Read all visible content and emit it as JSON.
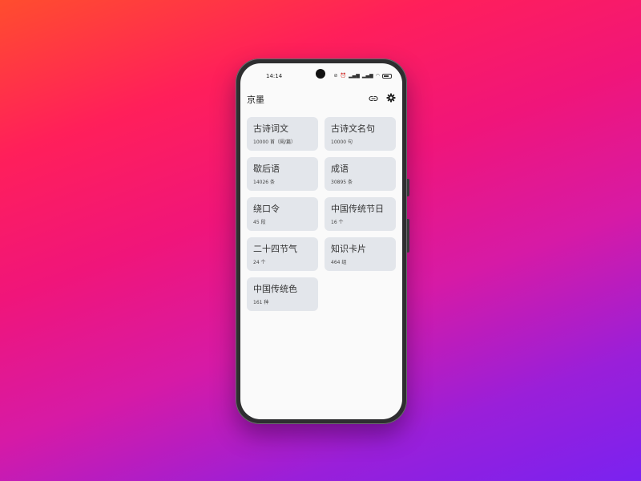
{
  "status_bar": {
    "time": "14:14",
    "icons": [
      "do-not-disturb-icon",
      "alarm-icon",
      "signal-icon-1",
      "signal-icon-2",
      "wifi-icon",
      "battery-icon"
    ]
  },
  "app_bar": {
    "title": "京墨",
    "actions": [
      "link-icon",
      "settings-icon"
    ]
  },
  "cards": [
    {
      "title": "古诗词文",
      "count": "10000 首（阕/篇）"
    },
    {
      "title": "古诗文名句",
      "count": "10000 句"
    },
    {
      "title": "歇后语",
      "count": "14026 条"
    },
    {
      "title": "成语",
      "count": "30895 条"
    },
    {
      "title": "绕口令",
      "count": "45 段"
    },
    {
      "title": "中国传统节日",
      "count": "16 个"
    },
    {
      "title": "二十四节气",
      "count": "24 个"
    },
    {
      "title": "知识卡片",
      "count": "464 组"
    },
    {
      "title": "中国传统色",
      "count": "161 种"
    }
  ],
  "colors": {
    "card_background": "#e3e6eb",
    "screen_background": "#fafafa"
  }
}
